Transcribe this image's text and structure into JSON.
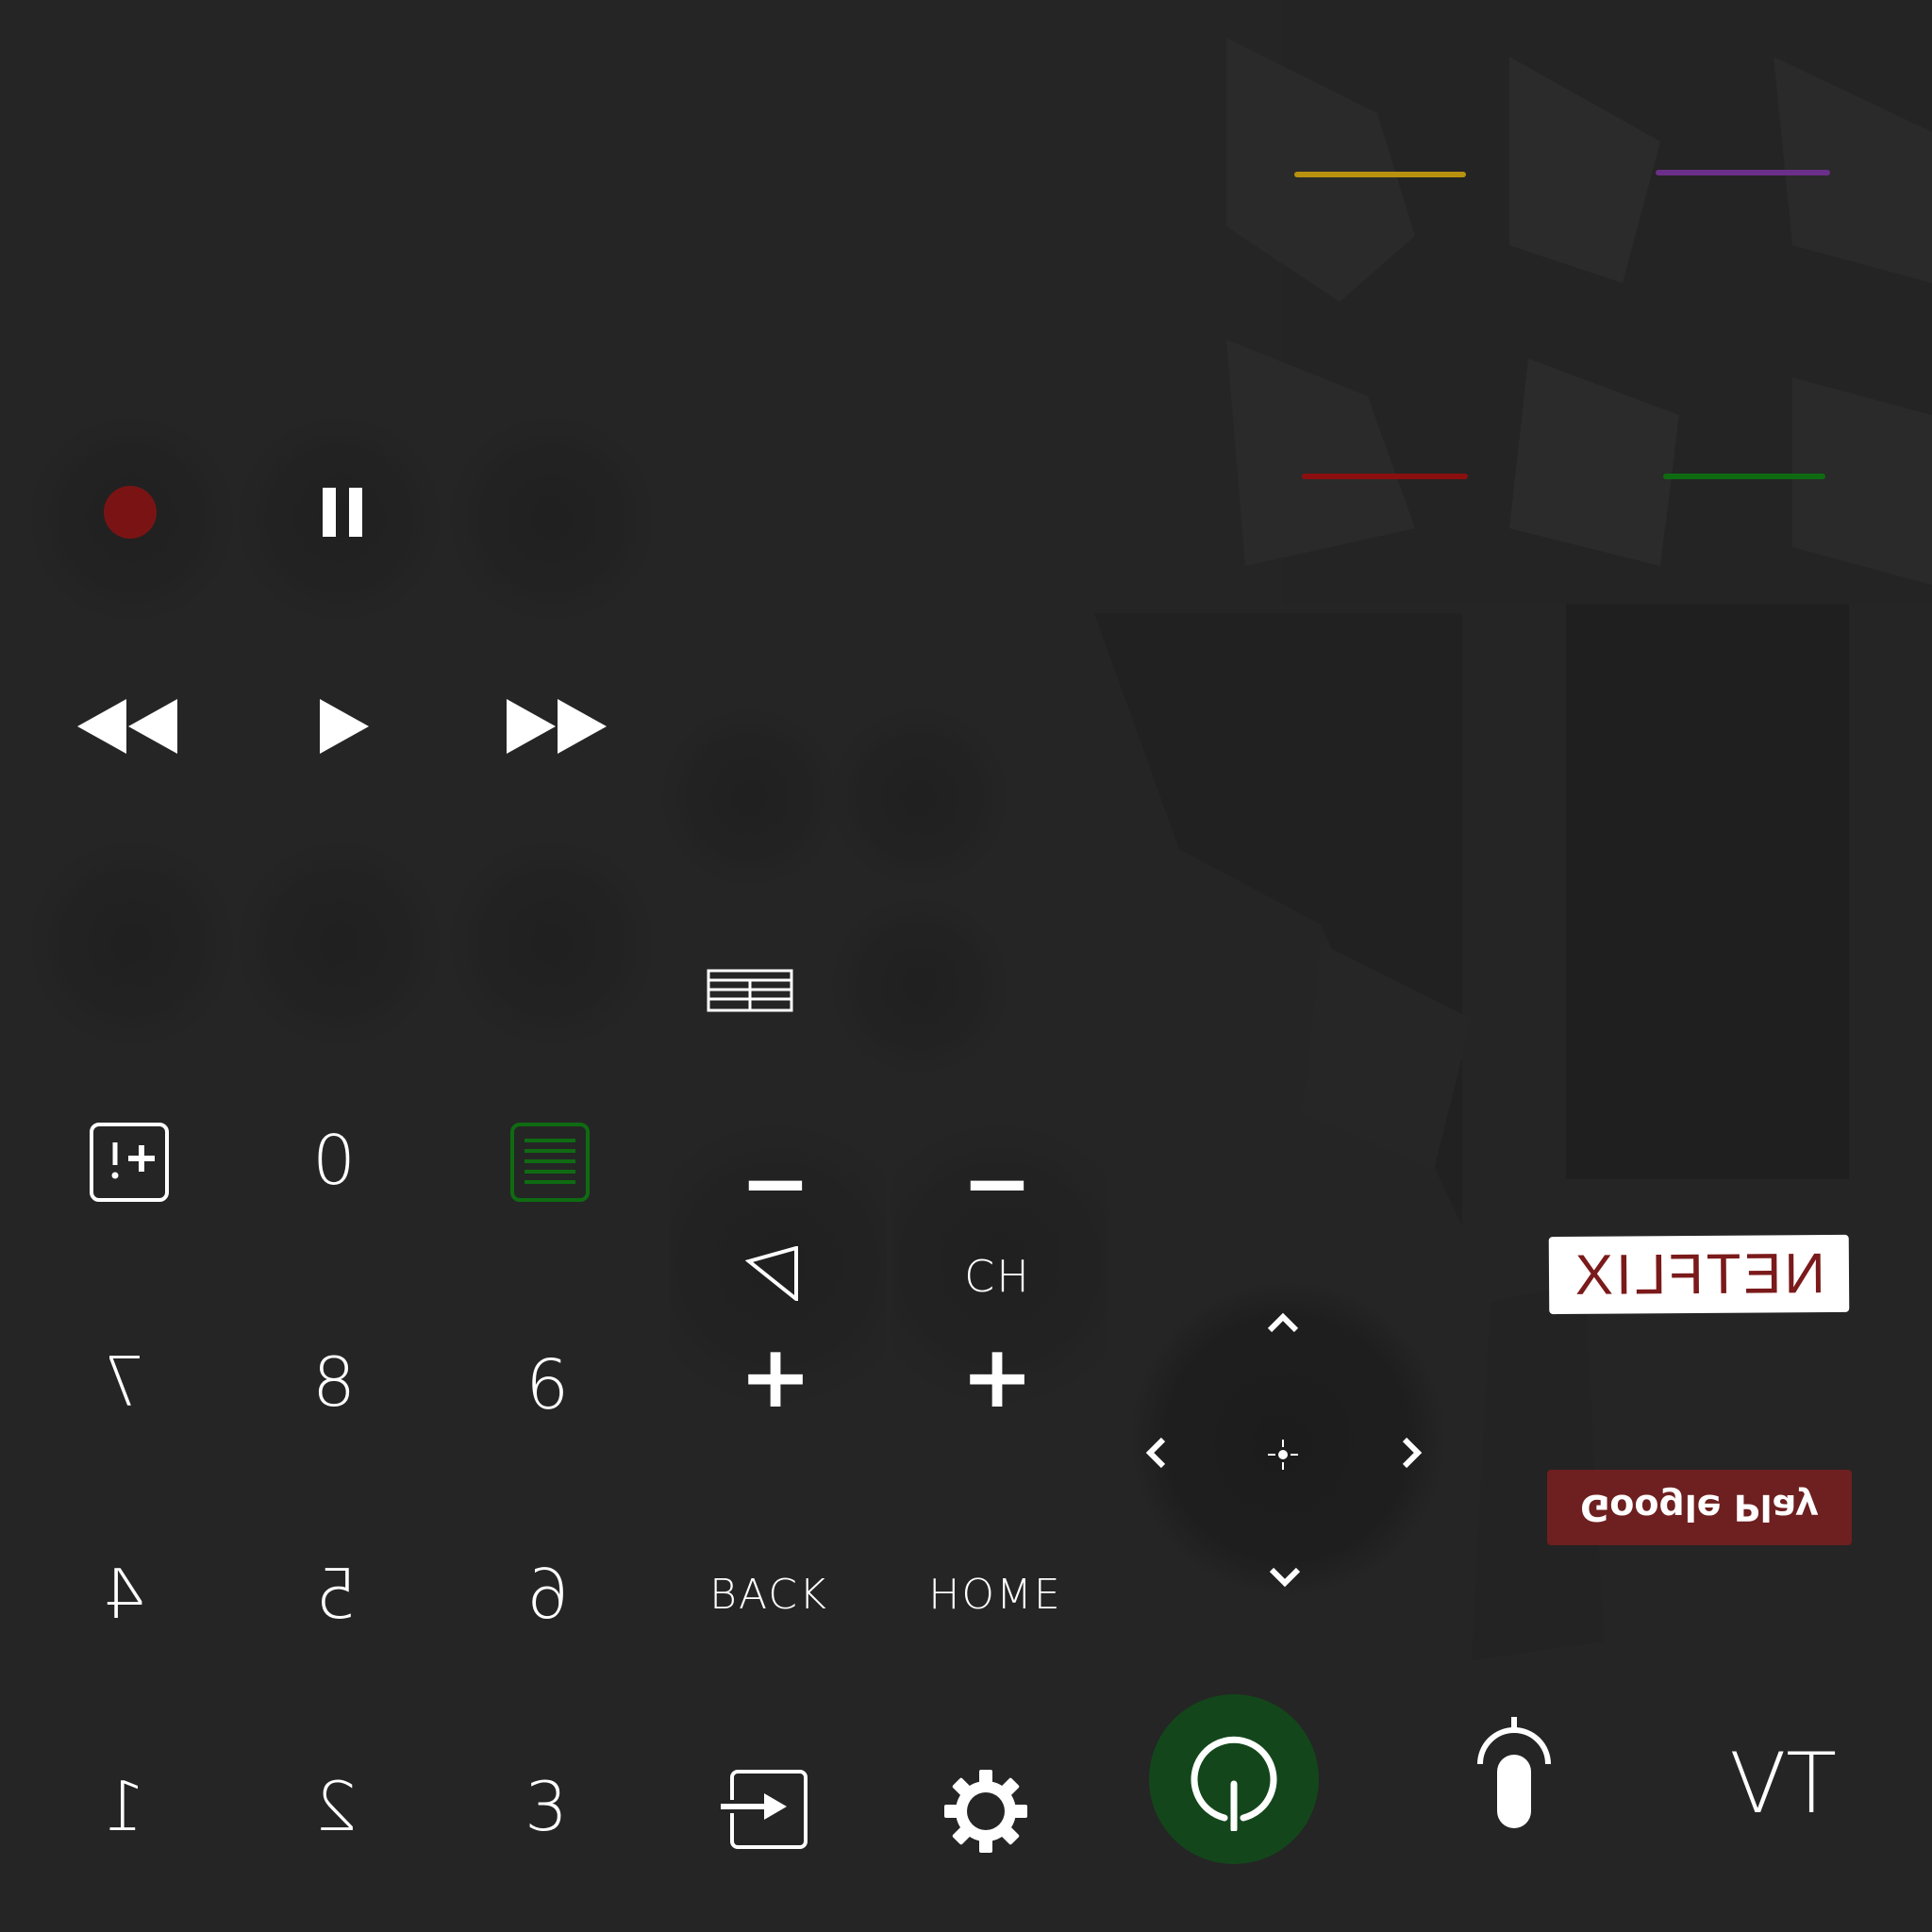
{
  "colors": {
    "background": "#252525",
    "record": "#7a1414",
    "yellow": "#b8920f",
    "purple": "#6b2f8a",
    "red": "#8c0f0f",
    "green": "#0f6b12",
    "power_bg": "#13471b",
    "netflix_text": "#7a1a1a",
    "google_play_bg": "#6e1f1f",
    "guide_green": "#0f6b12"
  },
  "keypad": {
    "digits": [
      "7",
      "8",
      "9",
      "4",
      "5",
      "6",
      "1",
      "2",
      "3",
      "0"
    ]
  },
  "volume": {
    "minus": "−",
    "plus": "+"
  },
  "channel": {
    "label": "CH",
    "minus": "−",
    "plus": "+"
  },
  "nav": {
    "back_label": "BACK",
    "home_label": "HOME"
  },
  "apps": {
    "netflix_label": "NETFLIX",
    "google_play_label": "Google Play"
  },
  "tv_label": "TV",
  "icons": {
    "record": "record-icon",
    "pause": "pause-icon",
    "rewind": "rewind-icon",
    "play": "play-icon",
    "fast_forward": "fast-forward-icon",
    "teletext": "teletext-icon",
    "info": "info-icon",
    "guide": "guide-icon",
    "volume": "volume-icon",
    "input": "input-icon",
    "settings": "gear-icon",
    "power": "power-icon",
    "microphone": "microphone-icon",
    "dpad": "dpad-icon"
  }
}
